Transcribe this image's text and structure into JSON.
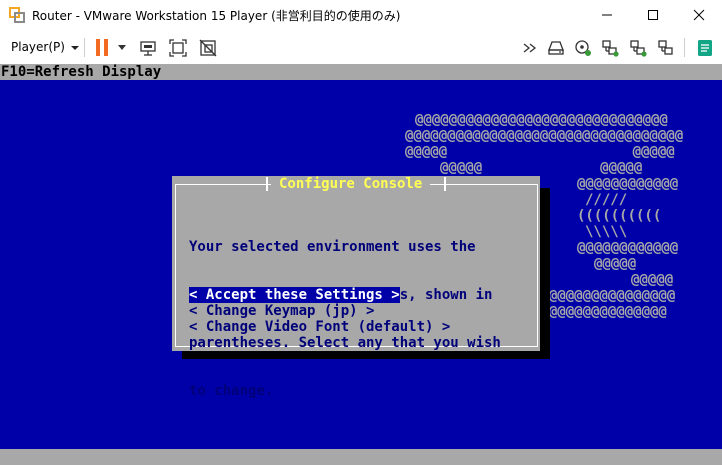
{
  "window": {
    "title": "Router - VMware Workstation 15 Player (非営利目的の使用のみ)"
  },
  "toolbar": {
    "player_menu_label": "Player(P)",
    "icons": [
      "pause-icon",
      "send-ctrl-alt-del-icon",
      "full-screen-icon",
      "unity-icon",
      "forward-icon",
      "hard-disk-icon",
      "cd-dvd-icon",
      "network-adapter-icon",
      "usb-device-icon",
      "sound-card-icon",
      "notes-icon"
    ]
  },
  "console": {
    "status_line": "F10=Refresh Display",
    "colors": {
      "background": "#0000a8",
      "bar": "#a8a8a8",
      "title": "#ffff54",
      "text": "#00007a",
      "selected_bg": "#0000a8",
      "selected_fg": "#ffffff"
    },
    "logo_lines": [
      "@@@@@@@@@@@@@@@@@@@@@@@@@@@@@@",
      "@@@@@@@@@@@@@@@@@@@@@@@@@@@@@@@@@",
      "@@@@@                      @@@@@",
      "@@@@@              @@@@@",
      "@@@@@@@@@@@@",
      "/////",
      "((((((((((",
      "\\\\\\\\\\",
      "@@@@@@@@@@@@",
      "@@@@@",
      "@@@@@",
      "@@@@@@@@@@@@@@@@@@@@@@@@@@@@@@@",
      "@@@@@@@@@@@@@@@@@@@@@@@@@@@@@@"
    ],
    "dialog": {
      "title": "Configure Console",
      "body_lines": [
        "Your selected environment uses the",
        "following console settings, shown in",
        "parentheses. Select any that you wish",
        "to change."
      ],
      "options": [
        "< Accept these Settings >",
        "< Change Keymap (jp) >",
        "< Change Video Font (default) >"
      ],
      "selected_option": "< Accept these Settings >"
    }
  }
}
